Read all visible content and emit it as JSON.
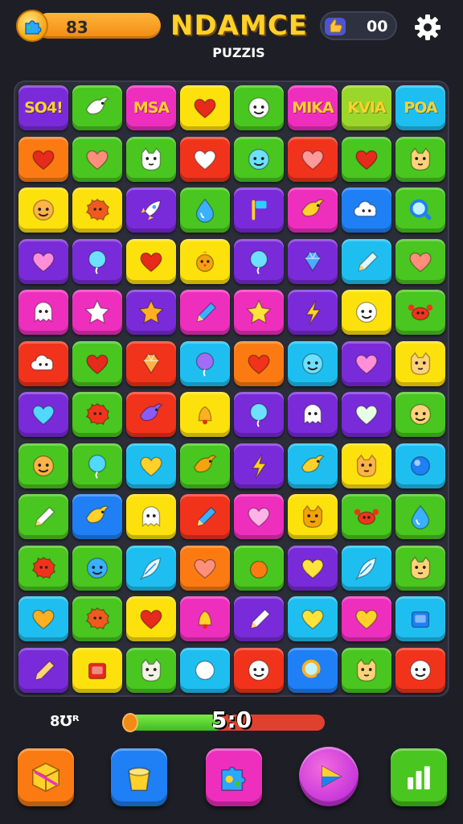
{
  "header": {
    "coins": "83",
    "title": "NDAMCE",
    "subtitle": "PUZZIS",
    "lives": "00"
  },
  "colors": {
    "red": "#f2331c",
    "orange": "#fb7b12",
    "yellow": "#fde10c",
    "green": "#49c61f",
    "cyan": "#1ebff0",
    "blue": "#1f7ff5",
    "purple": "#7a2bd9",
    "magenta": "#ee2fbe",
    "lime": "#9bd62a"
  },
  "board": {
    "rows": [
      [
        {
          "c": "purple",
          "t": "SO4!",
          "tc": "#ffd12a"
        },
        {
          "c": "green",
          "i": "bird-icon"
        },
        {
          "c": "magenta",
          "t": "MSA",
          "tc": "#ffd12a"
        },
        {
          "c": "yellow",
          "i": "heart-icon",
          "ic": "#e62a1c"
        },
        {
          "c": "green",
          "i": "face-icon"
        },
        {
          "c": "magenta",
          "t": "MIKA",
          "tc": "#ffd12a"
        },
        {
          "c": "lime",
          "t": "KVIA",
          "tc": "#ffd12a"
        },
        {
          "c": "cyan",
          "t": "POA",
          "tc": "#ffd12a"
        }
      ],
      [
        {
          "c": "orange",
          "i": "heart-icon",
          "ic": "#e62a1c"
        },
        {
          "c": "green",
          "i": "heart-icon",
          "ic": "#ff8f7a"
        },
        {
          "c": "green",
          "i": "cat-icon"
        },
        {
          "c": "red",
          "i": "heart-icon",
          "ic": "#ffffff"
        },
        {
          "c": "green",
          "i": "face-icon",
          "ic": "#6ee0ff"
        },
        {
          "c": "red",
          "i": "heart-icon",
          "ic": "#ff9a9a"
        },
        {
          "c": "green",
          "i": "heart-icon",
          "ic": "#e62a1c"
        },
        {
          "c": "green",
          "i": "cat-icon",
          "ic": "#ffd27a"
        }
      ],
      [
        {
          "c": "yellow",
          "i": "face-icon",
          "ic": "#ffb347"
        },
        {
          "c": "yellow",
          "i": "blob-icon",
          "ic": "#f05a1f"
        },
        {
          "c": "purple",
          "i": "rocket-icon"
        },
        {
          "c": "green",
          "i": "drop-icon",
          "ic": "#3ab0ff"
        },
        {
          "c": "purple",
          "i": "flag-icon"
        },
        {
          "c": "magenta",
          "i": "bird-icon",
          "ic": "#ffd12a"
        },
        {
          "c": "blue",
          "i": "cloud-icon"
        },
        {
          "c": "green",
          "i": "magnifier-icon"
        }
      ],
      [
        {
          "c": "purple",
          "i": "heart-icon",
          "ic": "#ff8fd8"
        },
        {
          "c": "purple",
          "i": "balloon-icon",
          "ic": "#6ee0ff"
        },
        {
          "c": "yellow",
          "i": "heart-icon",
          "ic": "#e62a1c"
        },
        {
          "c": "yellow",
          "i": "chick-icon",
          "ic": "#f5a20c"
        },
        {
          "c": "purple",
          "i": "balloon-icon",
          "ic": "#6ee0ff"
        },
        {
          "c": "purple",
          "i": "gem-icon",
          "ic": "#52a8ff"
        },
        {
          "c": "cyan",
          "i": "pencil-icon",
          "ic": "#dffbff"
        },
        {
          "c": "green",
          "i": "heart-icon",
          "ic": "#ff8f7a"
        }
      ],
      [
        {
          "c": "magenta",
          "i": "ghost-icon"
        },
        {
          "c": "magenta",
          "i": "star-icon",
          "ic": "#ffffff"
        },
        {
          "c": "purple",
          "i": "star-icon",
          "ic": "#ffb020"
        },
        {
          "c": "magenta",
          "i": "pencil-icon",
          "ic": "#3ab0ff"
        },
        {
          "c": "magenta",
          "i": "star-icon",
          "ic": "#ffe33a"
        },
        {
          "c": "purple",
          "i": "bolt-icon",
          "ic": "#ffd12a"
        },
        {
          "c": "yellow",
          "i": "face-icon",
          "ic": "#ffffff"
        },
        {
          "c": "green",
          "i": "crab-icon",
          "ic": "#f2331c"
        }
      ],
      [
        {
          "c": "red",
          "i": "cloud-icon"
        },
        {
          "c": "green",
          "i": "heart-icon",
          "ic": "#e62a1c"
        },
        {
          "c": "red",
          "i": "gem-icon",
          "ic": "#ffb347"
        },
        {
          "c": "cyan",
          "i": "balloon-icon",
          "ic": "#a06ef5"
        },
        {
          "c": "orange",
          "i": "heart-icon",
          "ic": "#f2331c"
        },
        {
          "c": "cyan",
          "i": "face-icon",
          "ic": "#6ee0ff"
        },
        {
          "c": "purple",
          "i": "heart-icon",
          "ic": "#ff8fd8"
        },
        {
          "c": "yellow",
          "i": "cat-icon",
          "ic": "#ffd27a"
        }
      ],
      [
        {
          "c": "purple",
          "i": "heart-icon",
          "ic": "#52d8ff"
        },
        {
          "c": "green",
          "i": "blob-icon",
          "ic": "#f2331c"
        },
        {
          "c": "red",
          "i": "bird-icon",
          "ic": "#8a5cf5"
        },
        {
          "c": "yellow",
          "i": "bell-icon",
          "ic": "#ffb020"
        },
        {
          "c": "purple",
          "i": "balloon-icon",
          "ic": "#6ee0ff"
        },
        {
          "c": "purple",
          "i": "ghost-icon"
        },
        {
          "c": "purple",
          "i": "heart-icon",
          "ic": "#e6ffe6"
        },
        {
          "c": "green",
          "i": "face-icon",
          "ic": "#ffd27a"
        }
      ],
      [
        {
          "c": "green",
          "i": "face-icon",
          "ic": "#ffb347"
        },
        {
          "c": "green",
          "i": "balloon-icon",
          "ic": "#52d8ff"
        },
        {
          "c": "cyan",
          "i": "heart-icon",
          "ic": "#ffd12a"
        },
        {
          "c": "green",
          "i": "bird-icon",
          "ic": "#f5a20c"
        },
        {
          "c": "purple",
          "i": "bolt-icon",
          "ic": "#ffd12a"
        },
        {
          "c": "cyan",
          "i": "bird-icon",
          "ic": "#ffd12a"
        },
        {
          "c": "yellow",
          "i": "cat-icon",
          "ic": "#ffb347"
        },
        {
          "c": "cyan",
          "i": "ball-icon",
          "ic": "#1f7ff5"
        }
      ],
      [
        {
          "c": "green",
          "i": "pencil-icon",
          "ic": "#ffffff"
        },
        {
          "c": "blue",
          "i": "bird-icon",
          "ic": "#ffd12a"
        },
        {
          "c": "yellow",
          "i": "ghost-icon"
        },
        {
          "c": "red",
          "i": "pencil-icon",
          "ic": "#3ab0ff"
        },
        {
          "c": "magenta",
          "i": "heart-icon",
          "ic": "#ffb3e6"
        },
        {
          "c": "yellow",
          "i": "cat-icon",
          "ic": "#f5a20c"
        },
        {
          "c": "green",
          "i": "crab-icon",
          "ic": "#f2331c"
        },
        {
          "c": "green",
          "i": "drop-icon",
          "ic": "#3ab0ff"
        }
      ],
      [
        {
          "c": "green",
          "i": "blob-icon",
          "ic": "#f2331c"
        },
        {
          "c": "green",
          "i": "face-icon",
          "ic": "#3ab0ff"
        },
        {
          "c": "cyan",
          "i": "feather-icon",
          "ic": "#dffbff"
        },
        {
          "c": "orange",
          "i": "heart-icon",
          "ic": "#ff8f7a"
        },
        {
          "c": "green",
          "i": "fruit-icon",
          "ic": "#fb7b12"
        },
        {
          "c": "purple",
          "i": "heart-icon",
          "ic": "#ffe33a"
        },
        {
          "c": "cyan",
          "i": "feather-icon",
          "ic": "#dffbff"
        },
        {
          "c": "green",
          "i": "cat-icon",
          "ic": "#ffd27a"
        }
      ],
      [
        {
          "c": "cyan",
          "i": "heart-icon",
          "ic": "#ffb020"
        },
        {
          "c": "green",
          "i": "blob-icon",
          "ic": "#f05a1f"
        },
        {
          "c": "yellow",
          "i": "heart-icon",
          "ic": "#e62a1c"
        },
        {
          "c": "magenta",
          "i": "bell-icon",
          "ic": "#ffd12a"
        },
        {
          "c": "purple",
          "i": "pencil-icon",
          "ic": "#ffffff"
        },
        {
          "c": "cyan",
          "i": "heart-icon",
          "ic": "#ffe33a"
        },
        {
          "c": "magenta",
          "i": "heart-icon",
          "ic": "#ffd12a"
        },
        {
          "c": "cyan",
          "i": "box-icon",
          "ic": "#1f7ff5"
        }
      ],
      [
        {
          "c": "purple",
          "i": "pencil-icon",
          "ic": "#ffd27a"
        },
        {
          "c": "yellow",
          "i": "box-icon",
          "ic": "#e62a1c"
        },
        {
          "c": "green",
          "i": "cat-icon",
          "ic": "#f2f2e6"
        },
        {
          "c": "cyan",
          "i": "ball-icon",
          "ic": "#ffffff"
        },
        {
          "c": "red",
          "i": "face-icon",
          "ic": "#ffffff"
        },
        {
          "c": "blue",
          "i": "magnifier-icon",
          "ic": "#ffb020"
        },
        {
          "c": "green",
          "i": "cat-icon",
          "ic": "#ffd27a"
        },
        {
          "c": "red",
          "i": "face-icon",
          "ic": "#ffffff"
        }
      ]
    ]
  },
  "footer": {
    "score_label": "8Ʊᴿ",
    "timer": "5:0",
    "progress": 0.5
  },
  "toolbar": [
    {
      "name": "cube-button",
      "c": "orange",
      "icon": "cube-icon"
    },
    {
      "name": "bucket-button",
      "c": "blue",
      "icon": "bucket-icon"
    },
    {
      "name": "puzzle-button",
      "c": "magenta",
      "icon": "puzzle-icon"
    },
    {
      "name": "play-button",
      "c": "magenta",
      "icon": "play-icon"
    },
    {
      "name": "stats-button",
      "c": "green",
      "icon": "stats-icon"
    }
  ]
}
